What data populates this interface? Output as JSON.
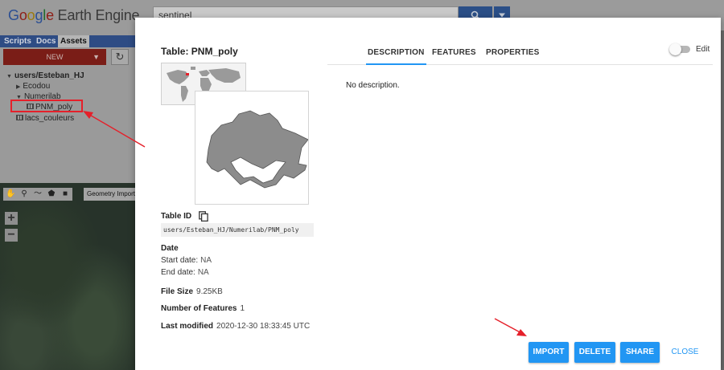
{
  "app": {
    "logo_text": "Google Earth Engine",
    "search_value": "sentinel"
  },
  "left_panel": {
    "tabs": [
      "Scripts",
      "Docs",
      "Assets"
    ],
    "active_tab": "Assets",
    "new_label": "NEW",
    "tree": {
      "root": "users/Esteban_HJ",
      "folder1": "Ecodou",
      "folder2": "Numerilab",
      "selected_item": "PNM_poly",
      "item2": "lacs_couleurs"
    }
  },
  "map": {
    "geometry_imports_label": "Geometry Imports",
    "zoom_in": "+",
    "zoom_out": "−"
  },
  "dialog": {
    "title": "Table: PNM_poly",
    "table_id_label": "Table ID",
    "table_id_value": "users/Esteban_HJ/Numerilab/PNM_poly",
    "date_label": "Date",
    "start_date_label": "Start date:",
    "start_date_value": "NA",
    "end_date_label": "End date:",
    "end_date_value": "NA",
    "file_size_label": "File Size",
    "file_size_value": "9.25KB",
    "num_features_label": "Number of Features",
    "num_features_value": "1",
    "last_modified_label": "Last modified",
    "last_modified_value": "2020-12-30 18:33:45 UTC",
    "tabs": {
      "description": "DESCRIPTION",
      "features": "FEATURES",
      "properties": "PROPERTIES"
    },
    "active_tab": "DESCRIPTION",
    "edit_label": "Edit",
    "edit_enabled": false,
    "description_text": "No description.",
    "buttons": {
      "import": "IMPORT",
      "delete": "DELETE",
      "share": "SHARE",
      "close": "CLOSE"
    }
  },
  "colors": {
    "primary_blue": "#2196f3",
    "annotation_red": "#e5202a",
    "polygon_fill": "#8c8c8c"
  },
  "icons": [
    "search-icon",
    "dropdown-icon",
    "refresh-icon",
    "copy-icon",
    "table-icon",
    "hand-icon",
    "marker-icon",
    "line-icon",
    "polygon-icon",
    "rectangle-icon"
  ]
}
